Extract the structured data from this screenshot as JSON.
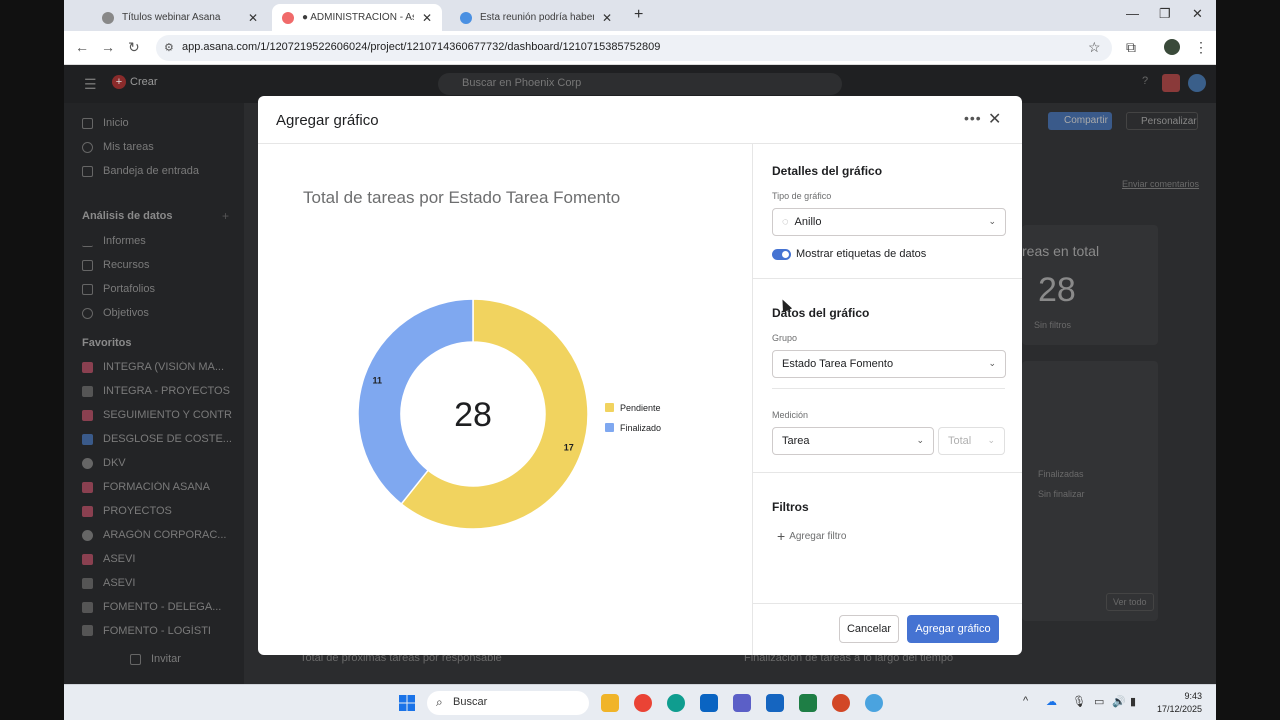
{
  "browser": {
    "tabs": [
      {
        "title": "Títulos webinar Asana",
        "active": false
      },
      {
        "title": "● ADMINISTRACIÓN - Asana (",
        "active": true
      },
      {
        "title": "Esta reunión podría haber sido",
        "active": false
      }
    ],
    "url": "app.asana.com/1/1207219522606024/project/1210714360677732/dashboard/1210715385752809"
  },
  "app": {
    "create_label": "Crear",
    "search_placeholder": "Buscar en Phoenix Corp",
    "sidebar": {
      "main_items": [
        "Inicio",
        "Mis tareas",
        "Bandeja de entrada"
      ],
      "section_analytics": "Análisis de datos",
      "analytics_items": [
        "Informes",
        "Recursos",
        "Portafolios",
        "Objetivos"
      ],
      "section_favorites": "Favoritos",
      "favorites": [
        "INTEGRA (VISIÓN MA...",
        "INTEGRA - PROYECTOS",
        "SEGUIMIENTO Y CONTROL",
        "DESGLOSE DE COSTE...",
        "DKV",
        "FORMACIÓN ASANA",
        "PROYECTOS",
        "ARAGÓN CORPORAC...",
        "ASEVI",
        "ASEVI",
        "FOMENTO - DELEGA...",
        "FOMENTO - LOGÍSTI"
      ],
      "invite_label": "Invitar"
    },
    "background": {
      "share_label": "Compartir",
      "customize_label": "Personalizar",
      "feedback_label": "Enviar comentarios",
      "total_title": "reas en total",
      "total_value": "28",
      "total_filter": "Sin filtros",
      "legend_done": "Finalizadas",
      "legend_notdone": "Sin finalizar",
      "see_all": "Ver todo",
      "bottom_left_title": "Total de próximas tareas por responsable",
      "bottom_right_title": "Finalización de tareas a lo largo del tiempo"
    }
  },
  "modal": {
    "title": "Agregar gráfico",
    "details_title": "Detalles del gráfico",
    "chart_type_label": "Tipo de gráfico",
    "chart_type_value": "Anillo",
    "show_labels_label": "Mostrar etiquetas de datos",
    "show_labels_on": true,
    "data_title": "Datos del gráfico",
    "group_label": "Grupo",
    "group_value": "Estado Tarea Fomento",
    "measure_label": "Medición",
    "measure_value": "Tarea",
    "measure_agg": "Total",
    "filters_title": "Filtros",
    "add_filter_label": "Agregar filtro",
    "cancel_label": "Cancelar",
    "submit_label": "Agregar gráfico"
  },
  "chart_data": {
    "type": "pie",
    "title": "Total de tareas por Estado Tarea Fomento",
    "center_label": "28",
    "categories": [
      "Pendiente",
      "Finalizado"
    ],
    "values": [
      17,
      11
    ],
    "colors": [
      "#f1d35f",
      "#7fa8f0"
    ],
    "legend_position": "right"
  },
  "taskbar": {
    "search_label": "Buscar",
    "time": "9:43",
    "date": "17/12/2025"
  }
}
